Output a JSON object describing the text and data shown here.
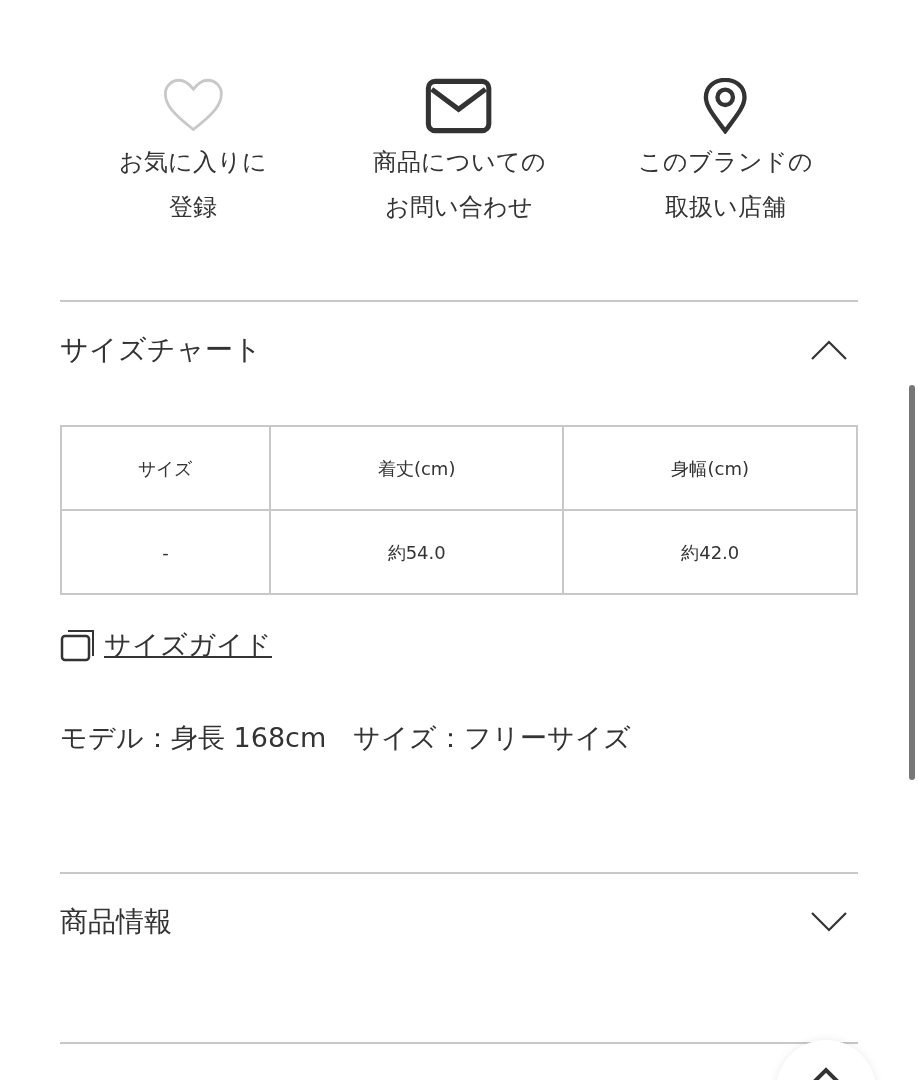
{
  "actions": [
    {
      "kind": "heart",
      "label_lines": [
        "お気に入りに",
        "登録"
      ],
      "selected": false
    },
    {
      "kind": "mail",
      "label_lines": [
        "商品についての",
        "お問い合わせ"
      ]
    },
    {
      "kind": "pin",
      "label_lines": [
        "このブランドの",
        "取扱い店舗"
      ]
    }
  ],
  "sections": [
    {
      "kind": "size_chart",
      "title": "サイズチャート",
      "expanded": true,
      "table": {
        "columns": [
          "サイズ",
          "着丈(cm)",
          "身幅(cm)"
        ],
        "rows": [
          [
            "-",
            "約54.0",
            "約42.0"
          ]
        ]
      },
      "guide_link": "サイズガイド",
      "model_note": "モデル：身長 168cm　サイズ：フリーサイズ"
    },
    {
      "kind": "plain",
      "title": "商品情報",
      "expanded": false
    }
  ]
}
